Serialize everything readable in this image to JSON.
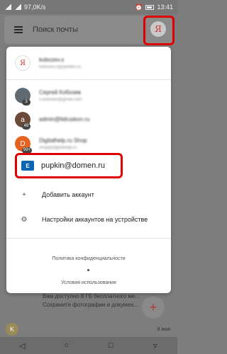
{
  "status": {
    "speed": "97,0K/s",
    "time": "13:41"
  },
  "search": {
    "placeholder": "Поиск почты",
    "avatar_letter": "Я"
  },
  "accounts": [
    {
      "avatar_letter": "Я",
      "avatar_color": "#ffffff",
      "avatar_text_color": "#d32f2f",
      "name": "kobozev.s",
      "email": "kobozev.s@yandex.ru",
      "badge": ""
    },
    {
      "avatar_letter": "",
      "avatar_color": "#5f6a72",
      "avatar_text_color": "#ffffff",
      "name": "Сергей Кобозев",
      "email": "s.kobozev@gmail.com",
      "badge": "3"
    },
    {
      "avatar_letter": "a",
      "avatar_color": "#6b4a3a",
      "avatar_text_color": "#ffffff",
      "name": "admin@lidruskon.ru",
      "email": "",
      "badge": "49"
    },
    {
      "avatar_letter": "D",
      "avatar_color": "#e8621f",
      "avatar_text_color": "#ffffff",
      "name": "Digitalhelp.ru Shop",
      "email": "shop@digitalhelp.ru",
      "badge": "99+"
    }
  ],
  "exchange_account": {
    "icon_text": "E",
    "email": "pupkin@domen.ru"
  },
  "menu": [
    {
      "icon": "person-add-icon",
      "glyph": "+",
      "label": "Добавить аккаунт"
    },
    {
      "icon": "manage-accounts-icon",
      "glyph": "⚙",
      "label": "Настройки аккаунтов на устройстве"
    }
  ],
  "footer": {
    "privacy": "Политика конфиденциальности",
    "terms": "Условия использования"
  },
  "background": {
    "preview1": "Сохраните фотографии и докумен...",
    "preview2": "Вам доступно 8 ГБ бесплатного ме...",
    "date": "8 мая"
  },
  "colors": {
    "highlight": "#e00000",
    "exchange_blue": "#0a66b5"
  }
}
